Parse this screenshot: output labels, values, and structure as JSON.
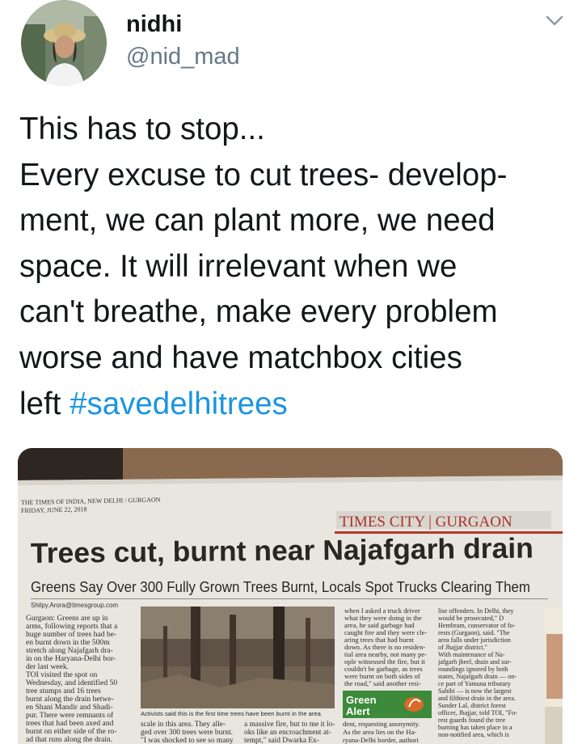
{
  "user": {
    "display_name": "nidhi",
    "handle": "@nid_mad",
    "avatar_icon": "profile-photo"
  },
  "tweet": {
    "lines": [
      "This has to stop...",
      "Every excuse to cut trees- develop-",
      "ment, we can plant more, we need",
      "space. It will irrelevant when we",
      "can't breathe, make every problem",
      "worse and have matchbox cities"
    ],
    "last_line_prefix": "left ",
    "hashtag": "#savedelhitrees"
  },
  "newspaper": {
    "masthead_line1": "THE TIMES OF INDIA, NEW DELHI / GURGAON",
    "masthead_line2": "FRIDAY, JUNE 22, 2018",
    "section": "TIMES CITY | GURGAON",
    "headline": "Trees cut, burnt near Najafgarh drain",
    "subhead": "Greens Say Over 300 Fully Grown Trees Burnt, Locals Spot Trucks Clearing Them",
    "byline": "Shilpy.Arora@timesgroup.com",
    "col1": [
      "Gurgaon: Greens are up in",
      "arms, following reports that a",
      "huge number of trees had be-",
      "en burnt down in the 500m",
      "stretch along Najafgarh dra-",
      "in on the Haryana-Delhi bor-",
      "der last week.",
      "TOI visited the spot on",
      "Wednesday, and identified 50",
      "tree stumps and 16 trees",
      "burnt along the drain betwe-",
      "en Shani Mandir and Shadi-",
      "pur. There were remnants of",
      "trees that had been axed and",
      "burnt on either side of the ro-",
      "ad that runs along the drain."
    ],
    "photo_caption": "Activists said this is the first time trees have been burnt in the area",
    "col2": [
      "scale in this area. They alle-",
      "ged over 300 trees were burnt.",
      "\"I was shocked to see so many"
    ],
    "col3_top": [
      "when I asked a truck driver",
      "what they were doing in the",
      "area, he said garbage had",
      "caught fire and they were cle-",
      "aring trees that had burnt",
      "down. As there is no residen-",
      "tial area nearby, not many pe-",
      "ople witnessed the fire, but it",
      "couldn't be garbage, as trees",
      "were burnt on both sides of",
      "the road,\" said another resi-"
    ],
    "col3_bottom": [
      "a massive fire, but to me it lo-",
      "oks like an encroachment at-",
      "tempt,\" said Dwarka Ex-"
    ],
    "col4": [
      "dent, requesting anonymity.",
      "As the area lies on the Ha-",
      "ryana-Delhi border, authori"
    ],
    "col5": [
      "lise offenders. In Delhi, they",
      "would be prosecuted,\" D",
      "Hembram, conservator of fo-",
      "rests (Gurgaon), said. \"The",
      "area falls under jurisdiction",
      "of Jhajjar district.\"",
      "With maintenance of Na-",
      "jafgarh jheel, drain and sur-",
      "roundings ignored by both",
      "states, Najafgarh drain — on-",
      "ce part of Yamuna tributary",
      "Sahibi — is now the largest",
      "and filthiest drain in the area.",
      "Sunder Lal, district forest",
      "officer, Jhajjar, told TOI, \"Fo-",
      "rest guards found the tree",
      "burning has taken place in a",
      "non-notified area, which is"
    ],
    "badge_line1": "Green",
    "badge_line2": "Alert",
    "colors": {
      "headline_red": "#a8342c",
      "badge_green": "#3c8a3a",
      "hashtag_blue": "#1b95e0"
    }
  }
}
